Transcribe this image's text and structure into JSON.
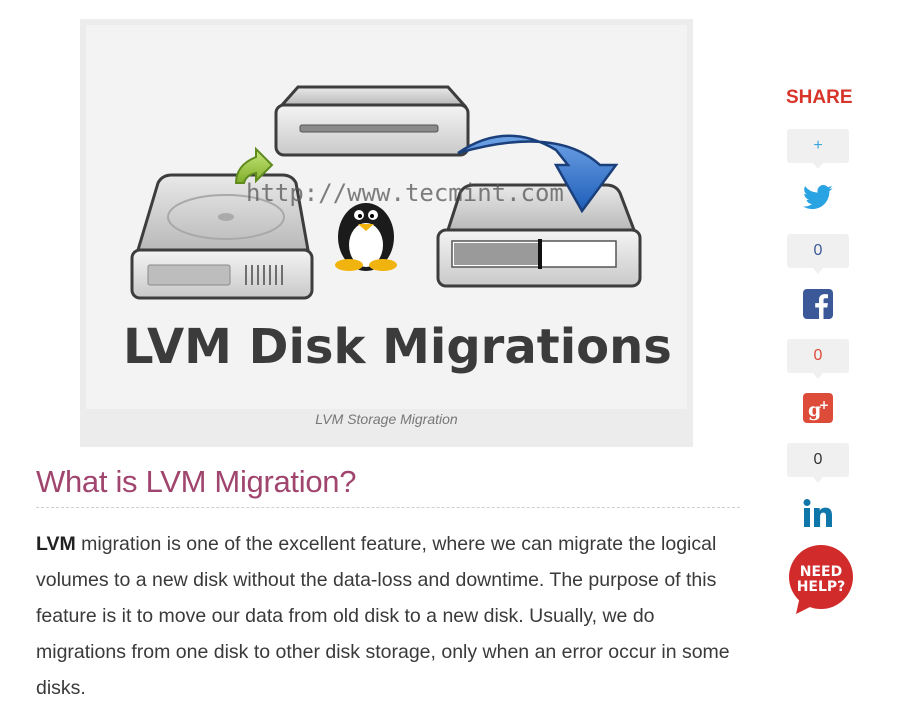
{
  "figure": {
    "watermark": "http://www.tecmint.com",
    "image_title": "LVM Disk Migrations",
    "caption": "LVM Storage Migration"
  },
  "article": {
    "heading": "What is LVM Migration?",
    "paragraph_bold": "LVM",
    "paragraph_rest": " migration is one of the excellent feature, where we can migrate the logical volumes to a new disk without the data-loss and downtime. The purpose of this feature is it to move our data from old disk to a new disk. Usually, we do migrations from one disk to other disk storage, only when an error occur in some disks."
  },
  "share": {
    "title": "SHARE",
    "buttons": [
      {
        "network": "twitter",
        "count": "+",
        "icon": "twitter-icon",
        "count_color": "#3aa3d8"
      },
      {
        "network": "facebook",
        "count": "0",
        "icon": "facebook-icon",
        "count_color": "#3b5998"
      },
      {
        "network": "google-plus",
        "count": "0",
        "icon": "google-plus-icon",
        "count_color": "#dd4b39"
      },
      {
        "network": "linkedin",
        "count": "0",
        "icon": "linkedin-icon",
        "count_color": "#333333"
      }
    ],
    "help_badge_line1": "NEED",
    "help_badge_line2": "HELP?"
  },
  "colors": {
    "heading": "#a0456e",
    "share_title": "#d8352a",
    "twitter": "#2aa3e3",
    "facebook": "#3b5998",
    "google_plus": "#dd4b39",
    "linkedin": "#0e76a8",
    "help_badge": "#d22b2b"
  }
}
